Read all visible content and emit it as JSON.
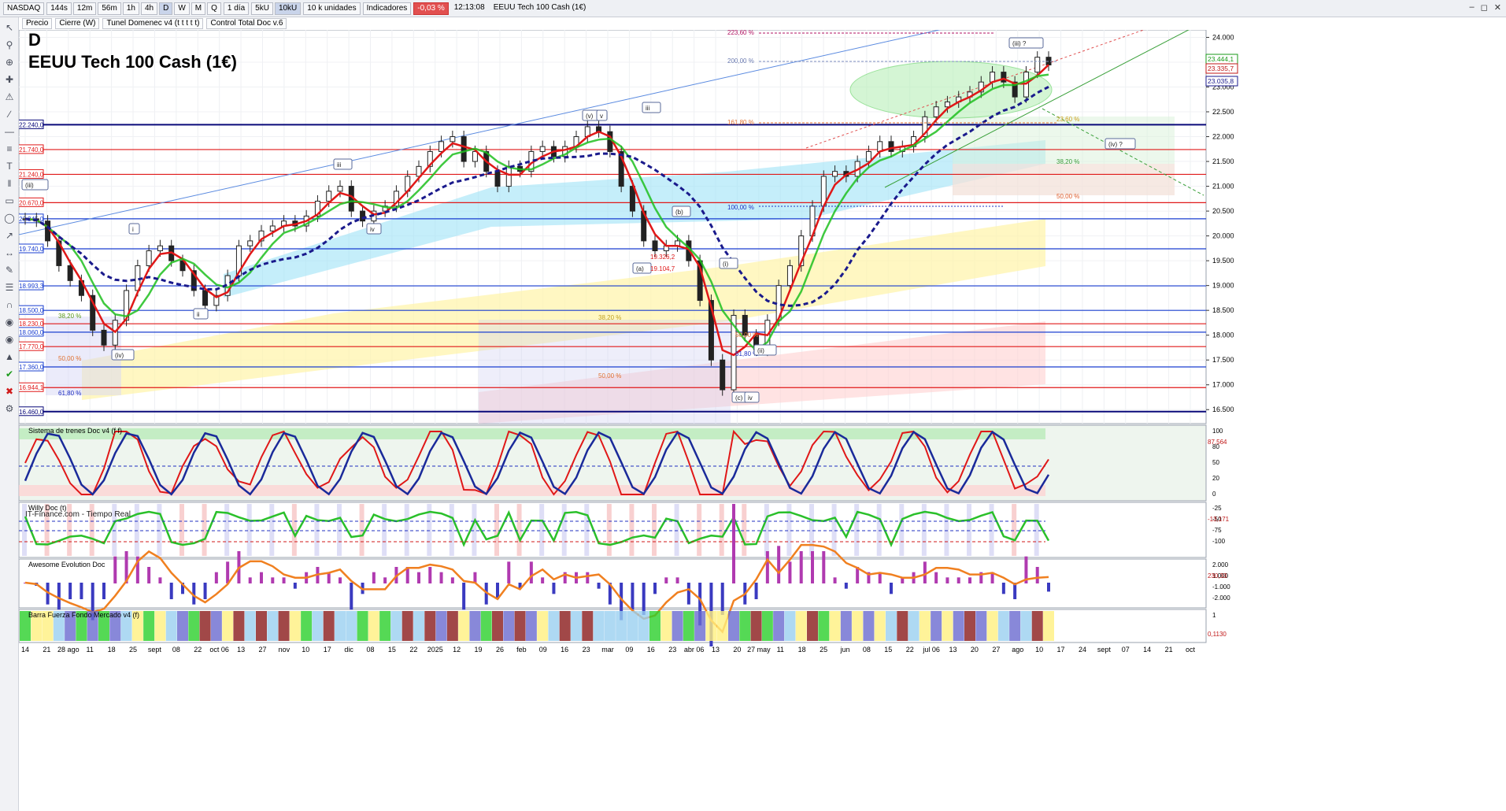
{
  "toolbar": {
    "symbol": "NASDAQ",
    "timeframes": [
      "144s",
      "12m",
      "56m",
      "1h",
      "4h",
      "D",
      "W",
      "M",
      "Q"
    ],
    "active_timeframe": "D",
    "period": "1 día",
    "units": [
      "5kU",
      "10kU"
    ],
    "active_unit": "10kU",
    "unit_select": "10 k unidades",
    "indicators": "Indicadores",
    "change": "-0,03 %",
    "time": "12:13:08",
    "instrument": "EEUU Tech 100 Cash (1€)"
  },
  "window_tabs": [
    "Precio",
    "Cierre (W)",
    "Tunel Domenec v4 (t t t t t)",
    "Control Total Doc v.6"
  ],
  "chart_header": {
    "letter": "D",
    "title": "EEUU Tech 100 Cash (1€)"
  },
  "source_note": "IT-Finance.com - Tiempo Real",
  "colors": {
    "price_up": "#0a8a2a",
    "price_down": "#b01818",
    "ma_red": "#e01818",
    "ma_green": "#1fc01f",
    "ma_blue_dashed": "#1a1a8c",
    "h_red": "#e01a1a",
    "h_blue": "#1a3fd0",
    "h_navy": "#0a0a7a",
    "cloud_cyan": "#9fe3f7",
    "cloud_yellow": "#fff3a8",
    "cloud_pink": "#ffd0d0"
  },
  "chart_data": {
    "type": "line",
    "title": "EEUU Tech 100 Cash (1€)",
    "x_tick_labels": [
      "14",
      "21",
      "28 ago",
      "11",
      "18",
      "25",
      "sept",
      "08",
      "22",
      "oct 06",
      "13",
      "27",
      "nov",
      "10",
      "17",
      "dic",
      "08",
      "15",
      "22",
      "2025",
      "12",
      "19",
      "26",
      "feb",
      "09",
      "16",
      "23",
      "mar",
      "09",
      "16",
      "23",
      "abr 06",
      "13",
      "20",
      "27 may",
      "11",
      "18",
      "25",
      "jun",
      "08",
      "15",
      "22",
      "jul 06",
      "13",
      "20",
      "27",
      "ago",
      "10",
      "17",
      "24",
      "sept",
      "07",
      "14",
      "21",
      "oct"
    ],
    "price_axis_ticks": [
      16500,
      17000,
      17500,
      18000,
      18500,
      19000,
      19500,
      20000,
      20500,
      21000,
      21500,
      22000,
      22500,
      23000,
      23500,
      24000
    ],
    "ylim": [
      16250,
      24150
    ],
    "series": [
      {
        "values": [
          20345,
          20300,
          19900,
          19400,
          19100,
          18800,
          18100,
          17800,
          18300,
          18900,
          19400,
          19700,
          19800,
          19500,
          19300,
          18900,
          18600,
          18800,
          19200,
          19800,
          19900,
          20100,
          20200,
          20300,
          20200,
          20400,
          20700,
          20900,
          21000,
          20500,
          20300,
          20500,
          20600,
          20900,
          21200,
          21400,
          21700,
          21900,
          22000,
          21500,
          21700,
          21300,
          21000,
          21400,
          21300,
          21700,
          21800,
          21600,
          21800,
          22000,
          22200,
          22100,
          21700,
          21000,
          20500,
          19900,
          19700,
          19800,
          19900,
          19500,
          18700,
          17500,
          16900,
          18400,
          18000,
          17700,
          18300,
          19000,
          19400,
          20000,
          20600,
          21200,
          21300,
          21200,
          21500,
          21700,
          21900,
          21700,
          21800,
          22000,
          22400,
          22600,
          22700,
          22800,
          22900,
          23100,
          23300,
          23100,
          22800,
          23300,
          23600,
          23444
        ]
      }
    ],
    "horizontal_level_labels": [
      "22.240,0",
      "21.740,0",
      "21.240,0",
      "20.670,0",
      "20.345,0",
      "19.740,0",
      "18.993,3",
      "18.500,0",
      "18.230,0",
      "18.060,0",
      "17.770,0",
      "17.360,0",
      "16.944,1",
      "16.460,0"
    ],
    "last_price_labels": [
      "23.444,1",
      "23.335,7",
      "23.035,8"
    ],
    "fib_labels": [
      "223,60 %",
      "200,00 %",
      "161,80 %",
      "100,00 %",
      "38,20 %",
      "50,00 %",
      "61,80 %",
      "23,60 %",
      "38,20 %",
      "50,00 %",
      "38,20 %",
      "50,00 %",
      "61,80 %",
      "50,00 %"
    ],
    "wave_labels": [
      "(iii)",
      "i",
      "ii",
      "iii",
      "iv",
      "(iv)",
      "(v)",
      "v",
      "iii",
      "(a)",
      "(b)",
      "(i)",
      "(ii)",
      "(c)",
      "iv",
      "(iii) ?",
      "(iv) ?"
    ],
    "price_box_labels": [
      "19.326,2",
      "19.104,7"
    ],
    "panels": [
      {
        "title": "Sistema de trenes Doc v4 (f f)",
        "axis_ticks": [
          "100",
          "80",
          "50",
          "20",
          "0"
        ],
        "last_value": "87,564"
      },
      {
        "title": "Willy Doc (t)",
        "axis_ticks": [
          "-25",
          "-50",
          "-75",
          "-100"
        ],
        "last_value": "-13,171"
      },
      {
        "title": "Awesome Evolution Doc",
        "axis_ticks": [
          "2.000",
          "1.000",
          "-1.000",
          "-2.000"
        ],
        "last_value": "230,33"
      },
      {
        "title": "Barra Fuerza Fondo Mercado v4 (f)",
        "axis_ticks": [
          "1"
        ],
        "last_value": "0,1130"
      }
    ]
  }
}
